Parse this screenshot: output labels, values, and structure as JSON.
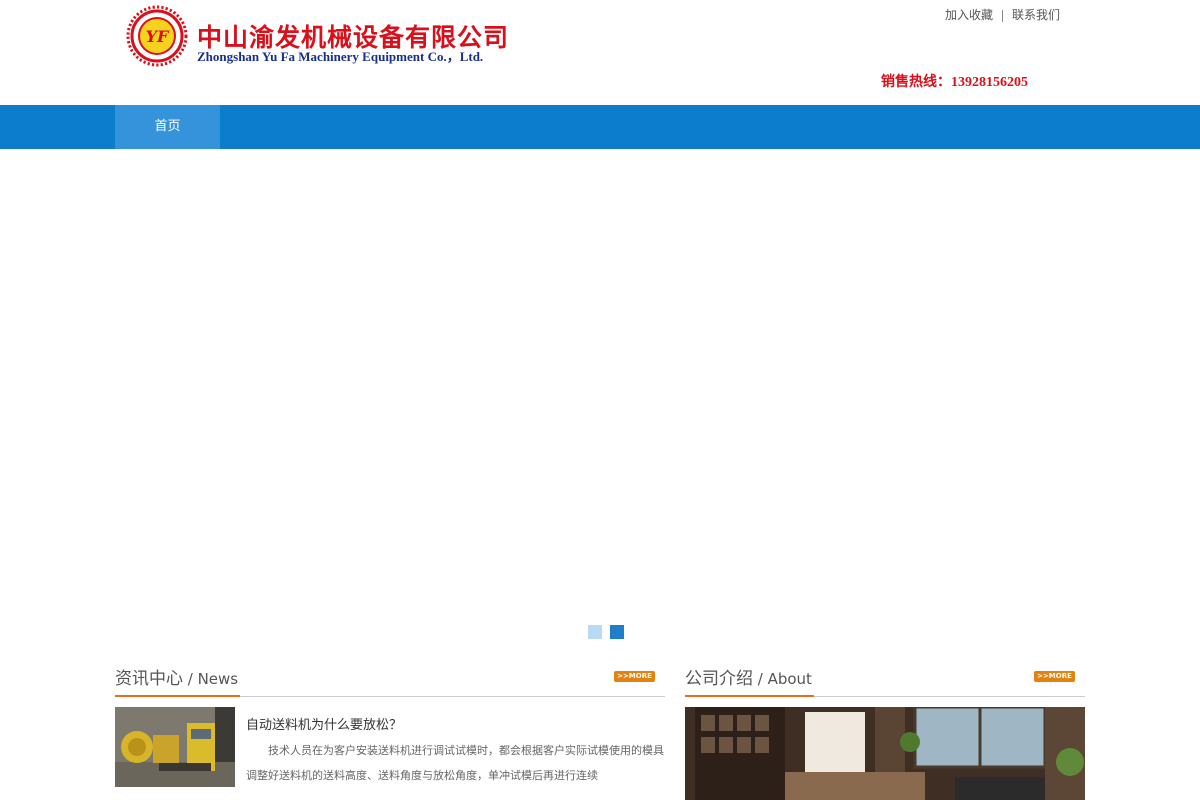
{
  "header": {
    "company_cn": "中山渝发机械设备有限公司",
    "company_en": "Zhongshan Yu Fa Machinery Equipment Co.，Ltd.",
    "logo_letters": "YF",
    "top_links": [
      "加入收藏",
      "联系我们"
    ],
    "hotline": "销售热线：13928156205"
  },
  "nav": {
    "items": [
      "首页"
    ]
  },
  "news": {
    "title_cn": "资讯中心",
    "title_en": " / News",
    "more_label": ">>MORE",
    "item": {
      "title": "自动送料机为什么要放松？",
      "summary": "技术人员在为客户安装送料机进行调试试模时，都会根据客户实际试模使用的模具调整好送料机的送料高度、送料角度与放松角度，单冲试模后再进行连续"
    }
  },
  "about": {
    "title_cn": "公司介绍",
    "title_en": " / About",
    "more_label": ">>MORE"
  },
  "colors": {
    "nav": "#0c7ccd",
    "nav_active": "#3493db",
    "accent_orange": "#e86f1a",
    "brand_red": "#d9101b",
    "brand_blue": "#1a2f8c"
  }
}
